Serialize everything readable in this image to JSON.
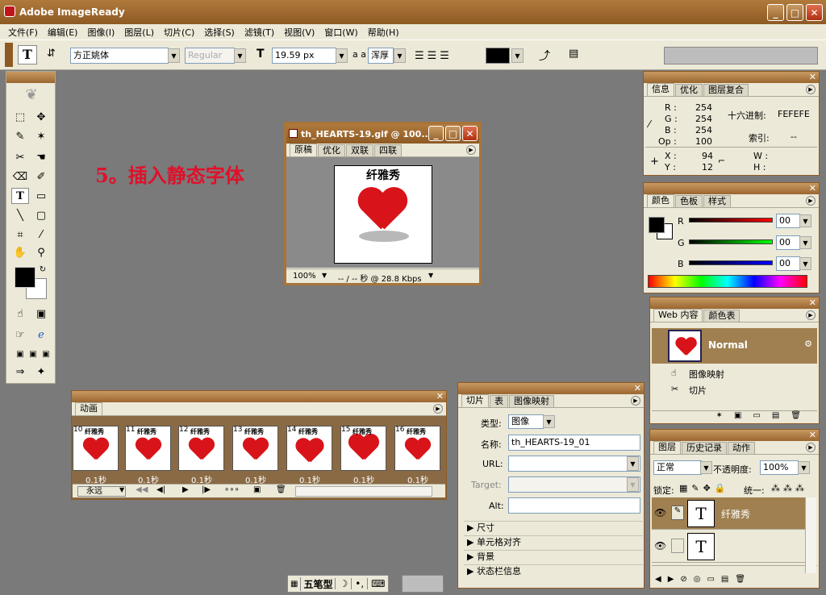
{
  "app": {
    "title": "Adobe ImageReady"
  },
  "menu": [
    "文件(F)",
    "编辑(E)",
    "图像(I)",
    "图层(L)",
    "切片(C)",
    "选择(S)",
    "滤镜(T)",
    "视图(V)",
    "窗口(W)",
    "帮助(H)"
  ],
  "options": {
    "font_family": "方正姚体",
    "font_style": "Regular",
    "font_size": "19.59 px",
    "anti_alias": "浑厚",
    "aa_label": "a a"
  },
  "annotation": "5。插入静态字体",
  "document": {
    "title": "th_HEARTS-19.gif @ 100...",
    "tabs": [
      "原稿",
      "优化",
      "双联",
      "四联"
    ],
    "image_text": "纤雅秀",
    "zoom": "100%",
    "status": "-- / -- 秒 @ 28.8 Kbps"
  },
  "info": {
    "tabs": [
      "信息",
      "优化",
      "图层复合"
    ],
    "r_label": "R :",
    "r": "254",
    "g_label": "G :",
    "g": "254",
    "b_label": "B :",
    "b": "254",
    "op_label": "Op :",
    "op": "100",
    "hex_label": "十六进制:",
    "hex": "FEFEFE",
    "index_label": "索引:",
    "index": "--",
    "x_label": "X :",
    "x": "94",
    "y_label": "Y :",
    "y": "12",
    "w_label": "W :",
    "h_label": "H :"
  },
  "color": {
    "tabs": [
      "颜色",
      "色板",
      "样式"
    ],
    "r_label": "R",
    "g_label": "G",
    "b_label": "B",
    "r": "00",
    "g": "00",
    "b": "00"
  },
  "web": {
    "tabs": [
      "Web 内容",
      "颜色表"
    ],
    "state": "Normal",
    "imagemap": "图像映射",
    "slices": "切片"
  },
  "animation": {
    "title": "动画",
    "frames": [
      {
        "num": "10",
        "time": "0.1秒"
      },
      {
        "num": "11",
        "time": "0.1秒"
      },
      {
        "num": "12",
        "time": "0.1秒"
      },
      {
        "num": "13",
        "time": "0.1秒"
      },
      {
        "num": "14",
        "time": "0.1秒"
      },
      {
        "num": "15",
        "time": "0.1秒"
      },
      {
        "num": "16",
        "time": "0.1秒"
      }
    ],
    "loop": "永远",
    "frame_text": "纤雅秀"
  },
  "slice": {
    "tabs": [
      "切片",
      "表",
      "图像映射"
    ],
    "type_label": "类型:",
    "type": "图像",
    "name_label": "名称:",
    "name": "th_HEARTS-19_01",
    "url_label": "URL:",
    "target_label": "Target:",
    "alt_label": "Alt:",
    "sections": [
      "尺寸",
      "单元格对齐",
      "背景",
      "状态栏信息"
    ]
  },
  "layers": {
    "tabs": [
      "图层",
      "历史记录",
      "动作"
    ],
    "blend": "正常",
    "opacity_label": "不透明度:",
    "opacity": "100%",
    "lock_label": "锁定:",
    "unify_label": "统一:",
    "layer1": "纤雅秀"
  },
  "ime": {
    "mode": "五笔型"
  },
  "colors": {
    "chrome": "#8e5a24",
    "panel": "#ece9d8",
    "canvas": "#7a7a7a",
    "annotation": "#e0102a"
  }
}
